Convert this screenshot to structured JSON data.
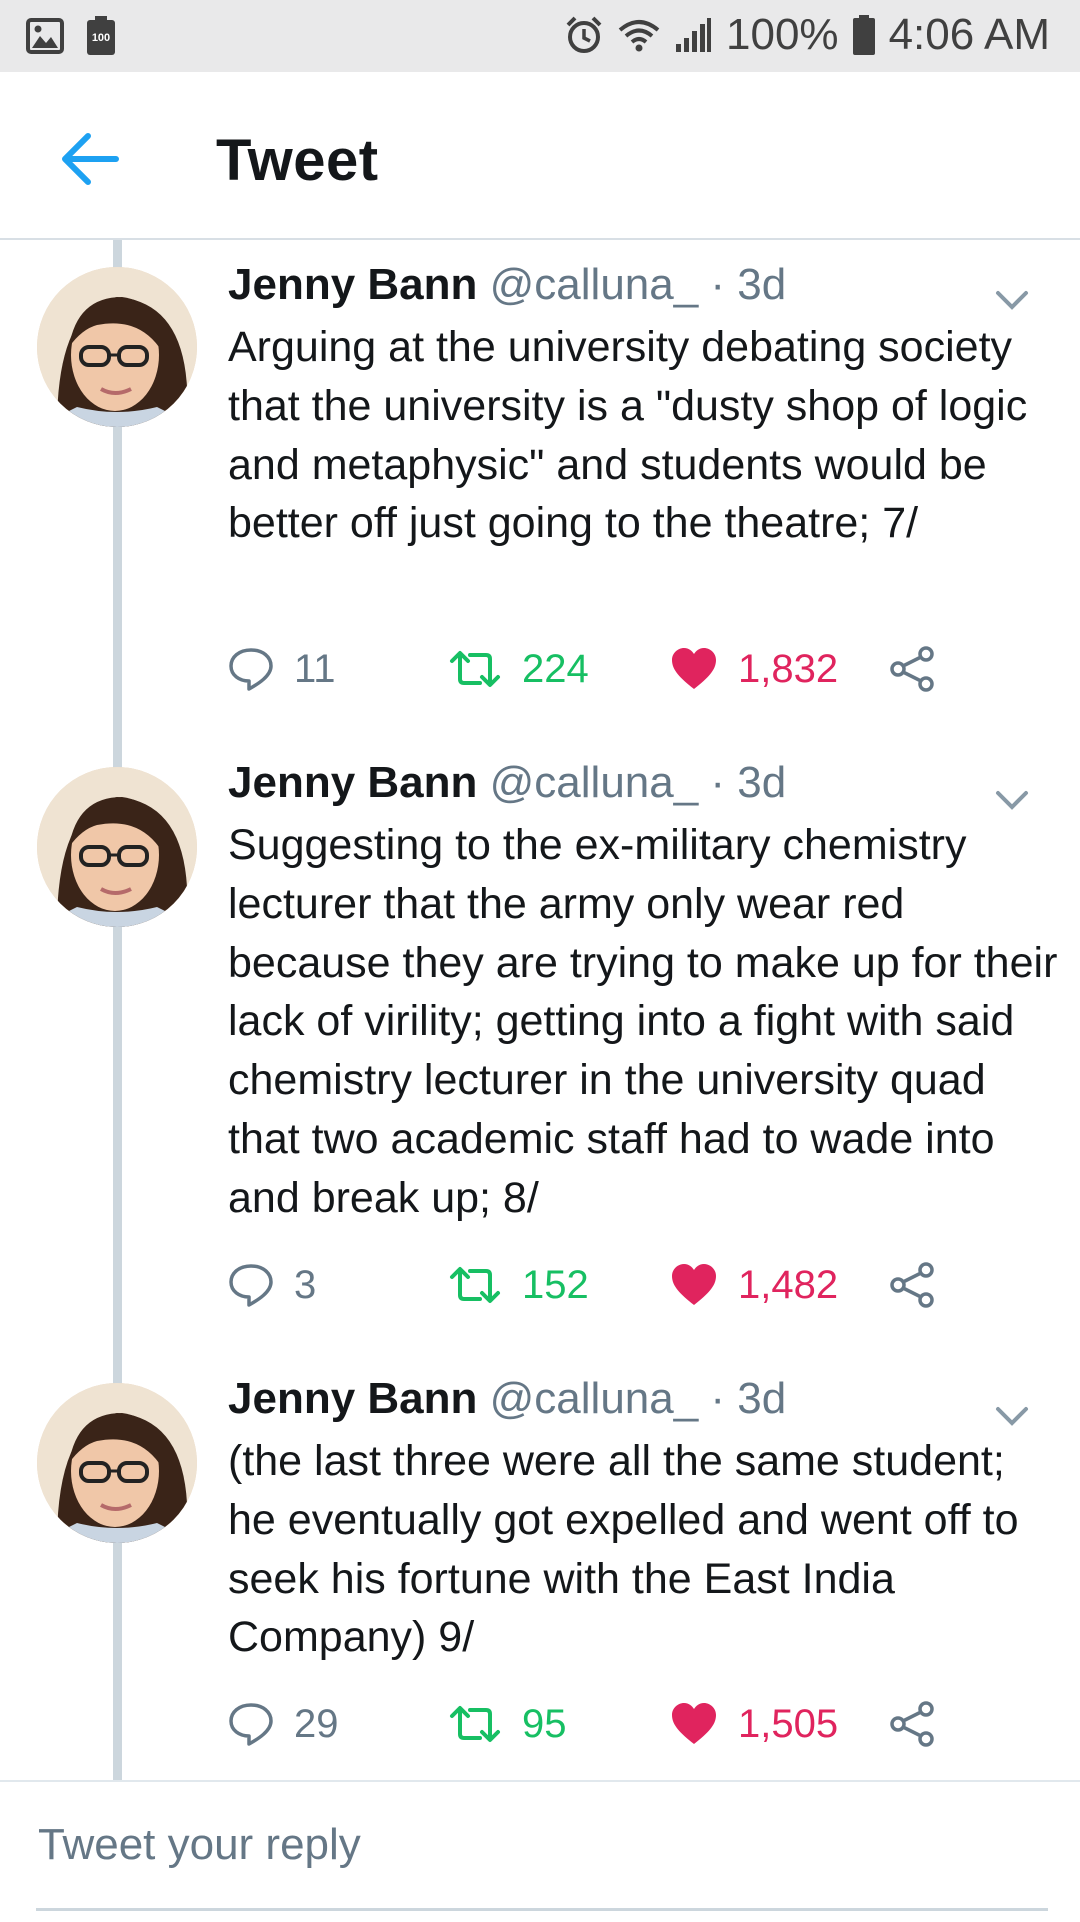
{
  "status_bar": {
    "notification_icons": [
      "image-icon",
      "battery-saver-icon"
    ],
    "battery_saver_label": "100",
    "right_icons": [
      "alarm-icon",
      "wifi-icon",
      "signal-icon",
      "battery-icon"
    ],
    "battery_percent": "100%",
    "time": "4:06 AM"
  },
  "header": {
    "back_icon": "arrow-left-icon",
    "title": "Tweet",
    "accent_color": "#1da1f2"
  },
  "tweets": [
    {
      "name": "Jenny Bann",
      "handle": "@calluna_",
      "time": " · 3d",
      "text": "Arguing at the university debating society that the university is a \"dusty shop of logic and metaphysic\" and students would be better off just going to the theatre; 7/",
      "replies": "11",
      "retweets": "224",
      "likes": "1,832",
      "liked": true,
      "retweeted": true
    },
    {
      "name": "Jenny Bann",
      "handle": "@calluna_",
      "time": " · 3d",
      "text": "Suggesting to the ex-military chemistry lecturer that the army only wear red because they are trying to make up for their lack of virility; getting into a fight with said chemistry lecturer in the university quad that two academic staff had to wade into and break up; 8/",
      "replies": "3",
      "retweets": "152",
      "likes": "1,482",
      "liked": true,
      "retweeted": true
    },
    {
      "name": "Jenny Bann",
      "handle": "@calluna_",
      "time": " · 3d",
      "text": "(the last three were all the same student; he eventually got expelled and went off to seek his fortune with the East India Company) 9/",
      "replies": "29",
      "retweets": "95",
      "likes": "1,505",
      "liked": true,
      "retweeted": true
    }
  ],
  "reply": {
    "placeholder": "Tweet your reply"
  },
  "colors": {
    "retweet_green": "#17bf63",
    "like_pink": "#e0245e",
    "muted_gray": "#657786",
    "thread_line": "#ccd6dd"
  }
}
